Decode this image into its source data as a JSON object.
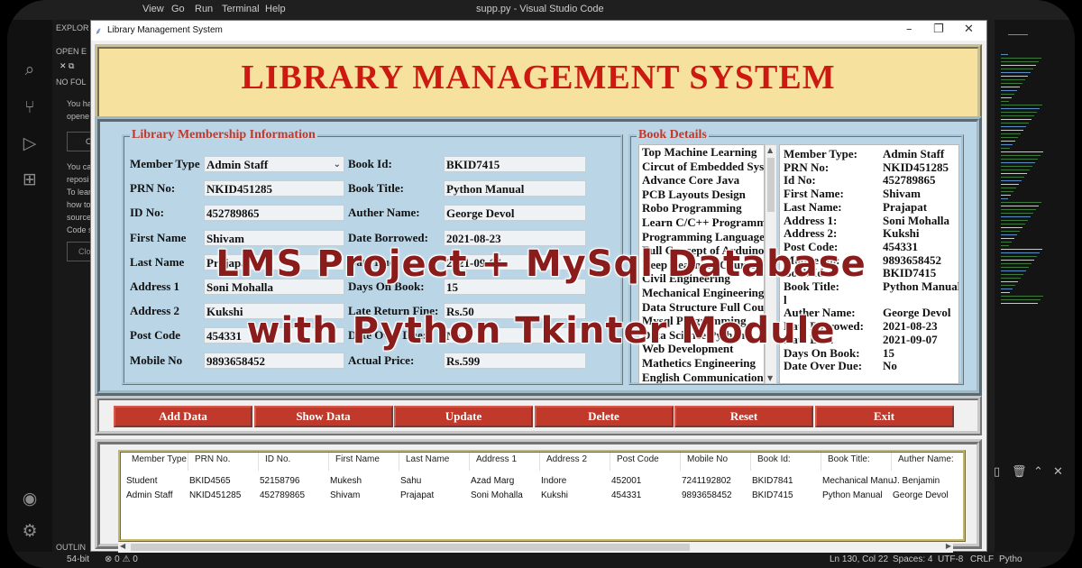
{
  "vscode": {
    "menu": [
      "View",
      "Go",
      "Run",
      "Terminal",
      "Help"
    ],
    "window_title": "supp.py - Visual Studio Code",
    "explorer": {
      "header": "EXPLOR",
      "open_editors": "OPEN E",
      "no_folder": "NO FOL",
      "text1": "You ha",
      "text2": "opene",
      "btn1": "O",
      "text3": "You ca",
      "text4": "reposi",
      "text5": "To lear",
      "text6": "how to",
      "text7": "source",
      "text8": "Code s",
      "btn2": "Clo",
      "outline": "OUTLIN"
    },
    "status": {
      "left": "54-bit",
      "problems": "⊗ 0 ⚠ 0",
      "position": "Ln 130, Col 22",
      "spaces": "Spaces: 4",
      "encoding": "UTF-8",
      "eol": "CRLF",
      "lang": "Pytho"
    }
  },
  "app": {
    "title": "Library Management System",
    "banner": "LIBRARY MANAGEMENT SYSTEM",
    "membership_legend": "Library Membership Information",
    "book_legend": "Book Details",
    "fields_left": [
      {
        "label": "Member Type",
        "value": "Admin Staff"
      },
      {
        "label": "PRN No:",
        "value": "NKID451285"
      },
      {
        "label": "ID No:",
        "value": "452789865"
      },
      {
        "label": "First Name",
        "value": "Shivam"
      },
      {
        "label": "Last Name",
        "value": "Prajapat"
      },
      {
        "label": "Address 1",
        "value": "Soni Mohalla"
      },
      {
        "label": "Address 2",
        "value": "Kukshi"
      },
      {
        "label": "Post Code",
        "value": "454331"
      },
      {
        "label": "Mobile No",
        "value": "9893658452"
      }
    ],
    "fields_right": [
      {
        "label": "Book Id:",
        "value": "BKID7415"
      },
      {
        "label": "Book Title:",
        "value": "Python Manual"
      },
      {
        "label": "Auther Name:",
        "value": "George Devol"
      },
      {
        "label": "Date Borrowed:",
        "value": "2021-08-23"
      },
      {
        "label": "Date Due:",
        "value": "2021-09-07"
      },
      {
        "label": "Days On Book:",
        "value": "15"
      },
      {
        "label": "Late Return Fine:",
        "value": "Rs.50"
      },
      {
        "label": "Date Over Due:",
        "value": "No"
      },
      {
        "label": "Actual Price:",
        "value": "Rs.599"
      }
    ],
    "books": [
      "Top Machine Learning",
      "Circut of Embedded System",
      "Advance Core Java",
      "PCB Layouts Design",
      "Robo Programming",
      "Learn C/C++ Programming",
      "Programming Language",
      "Full Concept of Arduino",
      "Deep Learning Courses",
      "Civil Engineering",
      "Mechanical Engineering",
      "Data Structure Full Course",
      "Mysql Programming",
      "Data Science Python",
      "Web Development",
      "Mathetics Engineering",
      "English Communication"
    ],
    "details": [
      {
        "label": "Member Type:",
        "value": "Admin Staff"
      },
      {
        "label": "PRN No:",
        "value": "NKID451285"
      },
      {
        "label": "Id No:",
        "value": "452789865"
      },
      {
        "label": "First Name:",
        "value": "Shivam"
      },
      {
        "label": "Last Name:",
        "value": "Prajapat"
      },
      {
        "label": "Address 1:",
        "value": "Soni Mohalla"
      },
      {
        "label": "Address 2:",
        "value": "Kukshi"
      },
      {
        "label": "Post Code:",
        "value": "454331"
      },
      {
        "label": "Mobile No:",
        "value": "9893658452"
      },
      {
        "label": "Book Id:",
        "value": "BKID7415"
      },
      {
        "label": "Book Title:",
        "value": "Python Manual"
      },
      {
        "label": "l",
        "value": ""
      },
      {
        "label": "Auther Name:",
        "value": "George Devol"
      },
      {
        "label": "Date Borrowed:",
        "value": "2021-08-23"
      },
      {
        "label": "Date Due:",
        "value": "2021-09-07"
      },
      {
        "label": "Days On Book:",
        "value": "15"
      },
      {
        "label": "Date Over Due:",
        "value": "No"
      }
    ],
    "buttons": [
      "Add Data",
      "Show Data",
      "Update",
      "Delete",
      "Reset",
      "Exit"
    ],
    "table": {
      "columns": [
        "Member Type",
        "PRN No.",
        "ID No.",
        "First Name",
        "Last Name",
        "Address 1",
        "Address 2",
        "Post Code",
        "Mobile No",
        "Book Id:",
        "Book Title:",
        "Auther Name:"
      ],
      "rows": [
        [
          "Student",
          "BKID4565",
          "52158796",
          "Mukesh",
          "Sahu",
          "Azad Marg",
          "Indore",
          "452001",
          "7241192802",
          "BKID7841",
          "Mechanical Manu",
          "J. Benjamin"
        ],
        [
          "Admin Staff",
          "NKID451285",
          "452789865",
          "Shivam",
          "Prajapat",
          "Soni Mohalla",
          "Kukshi",
          "454331",
          "9893658452",
          "BKID7415",
          "Python Manual",
          "George Devol"
        ]
      ]
    }
  },
  "overlay": {
    "line1": "LMS Project + MySql Database",
    "line2": "with Python Tkinter Module"
  }
}
